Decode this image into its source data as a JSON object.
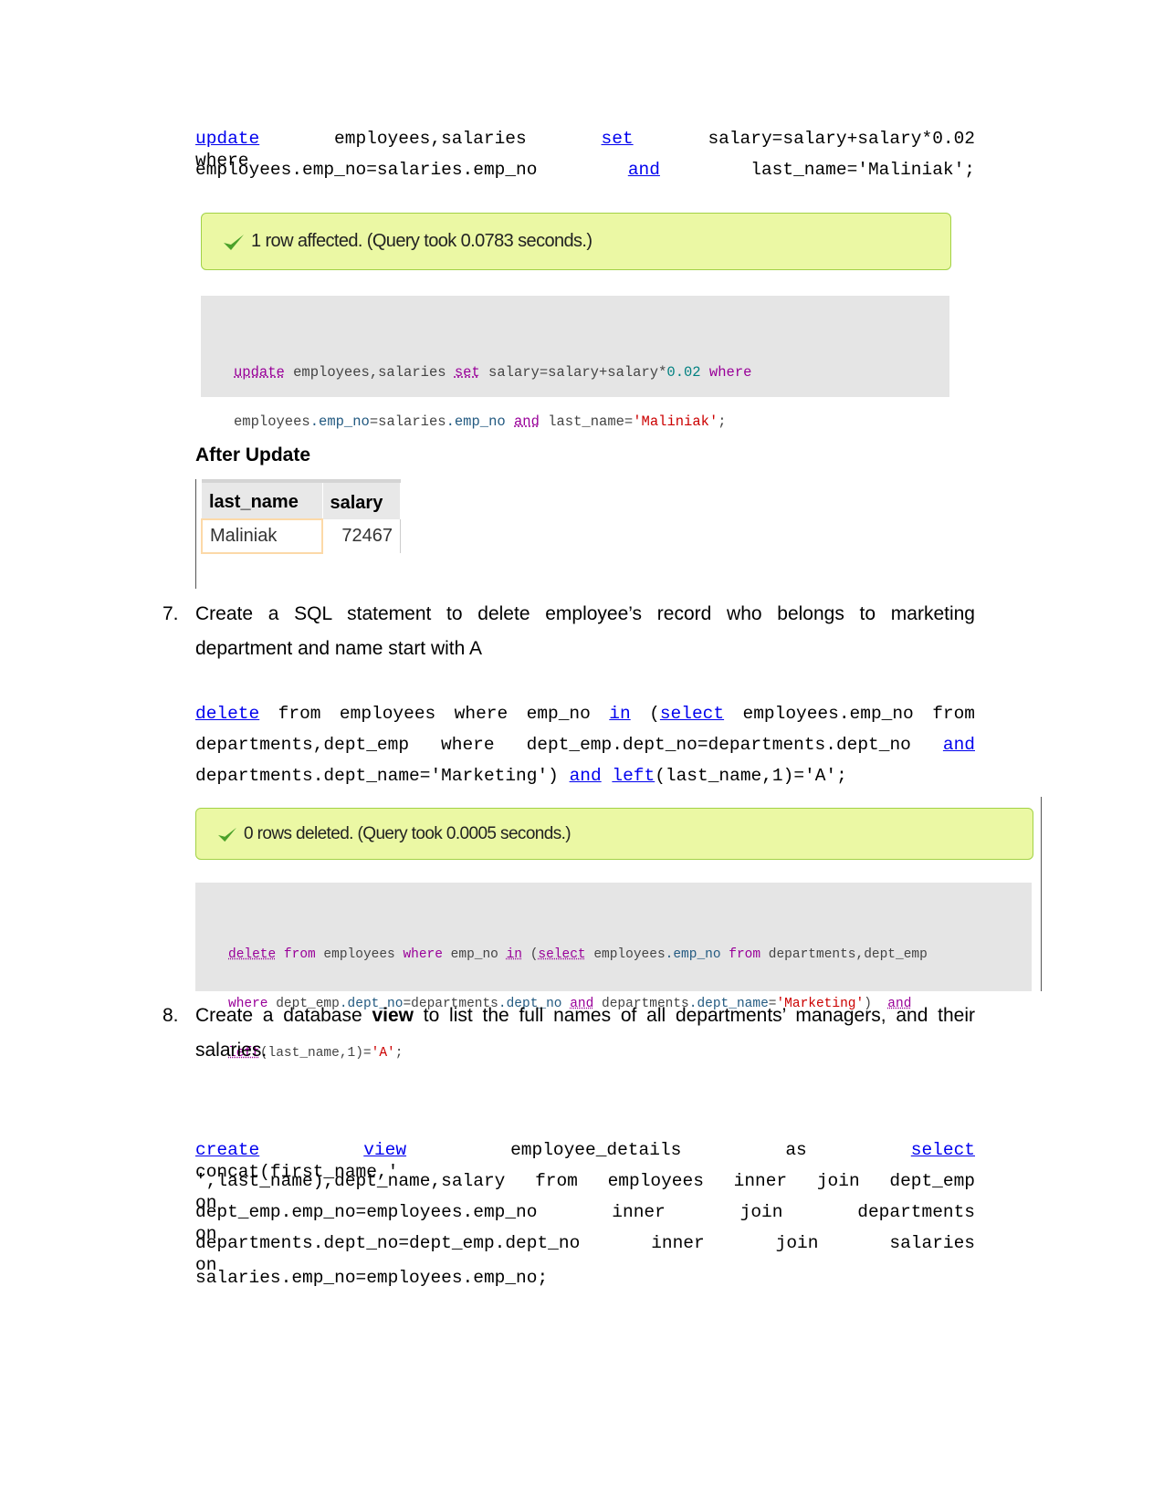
{
  "colors": {
    "link": "#0000ee",
    "success_bg": "#ebf8a4",
    "success_border": "#a2d246",
    "code_bg": "#e5e5e5",
    "keyword": "#990099",
    "field": "#235a81",
    "string": "#cc0000",
    "number": "#008080"
  },
  "update_sql": {
    "lines": [
      [
        {
          "t": "update",
          "link": true
        },
        {
          "t": "    employees,salaries    "
        },
        {
          "t": "set",
          "link": true
        },
        {
          "t": "    salary=salary+salary*0.02    where"
        }
      ],
      [
        {
          "t": "employees.emp_no=salaries.emp_no        "
        },
        {
          "t": "and",
          "link": true
        },
        {
          "t": "        last_name='Maliniak';"
        }
      ]
    ]
  },
  "update_result": {
    "icon": "check-icon",
    "message": "1 row affected. (Query took 0.0783 seconds.)"
  },
  "update_code": {
    "lines": [
      [
        {
          "t": "update",
          "c": "f"
        },
        {
          "t": " employees,salaries "
        },
        {
          "t": "set",
          "c": "f"
        },
        {
          "t": " salary=salary+salary*"
        },
        {
          "t": "0.02",
          "c": "n"
        },
        {
          "t": " "
        },
        {
          "t": "where",
          "c": "k"
        }
      ],
      [
        {
          "t": "employees"
        },
        {
          "t": ".emp_no",
          "c": "fd"
        },
        {
          "t": "=salaries"
        },
        {
          "t": ".emp_no",
          "c": "fd"
        },
        {
          "t": " "
        },
        {
          "t": "and",
          "c": "f"
        },
        {
          "t": " last_name="
        },
        {
          "t": "'Maliniak'",
          "c": "s"
        },
        {
          "t": ";"
        }
      ]
    ]
  },
  "after_update": {
    "heading": "After Update",
    "table": {
      "headers": [
        "last_name",
        "salary"
      ],
      "rows": [
        [
          "Maliniak",
          "72467"
        ]
      ]
    }
  },
  "q7": {
    "number": "7.",
    "lines": [
      "Create  a  SQL  statement  to  delete   employee’s  record  who  belongs  to  marketing",
      "department and name start with A"
    ]
  },
  "delete_sql": {
    "lines": [
      [
        {
          "t": "delete",
          "link": true
        },
        {
          "t": " from employees where emp_no "
        },
        {
          "t": "in",
          "link": true
        },
        {
          "t": " ("
        },
        {
          "t": "select",
          "link": true
        },
        {
          "t": " employees.emp_no from"
        }
      ],
      [
        {
          "t": "departments,dept_emp  where  dept_emp.dept_no=departments.dept_no  "
        },
        {
          "t": "and",
          "link": true
        }
      ],
      [
        {
          "t": "departments.dept_name='Marketing') "
        },
        {
          "t": "and",
          "link": true
        },
        {
          "t": " "
        },
        {
          "t": "left",
          "link": true
        },
        {
          "t": "(last_name,1)='A';"
        }
      ]
    ]
  },
  "delete_result": {
    "icon": "check-icon",
    "message": "0 rows deleted. (Query took 0.0005 seconds.)"
  },
  "delete_code": {
    "lines": [
      [
        {
          "t": "delete",
          "c": "f"
        },
        {
          "t": " "
        },
        {
          "t": "from",
          "c": "k"
        },
        {
          "t": " employees "
        },
        {
          "t": "where",
          "c": "k"
        },
        {
          "t": " emp_no "
        },
        {
          "t": "in",
          "c": "f"
        },
        {
          "t": " ("
        },
        {
          "t": "select",
          "c": "f"
        },
        {
          "t": " employees"
        },
        {
          "t": ".emp_no",
          "c": "fd"
        },
        {
          "t": " "
        },
        {
          "t": "from",
          "c": "k"
        },
        {
          "t": " departments,dept_emp"
        }
      ],
      [
        {
          "t": "where",
          "c": "k"
        },
        {
          "t": " dept_emp"
        },
        {
          "t": ".dept_no",
          "c": "fd"
        },
        {
          "t": "=departments"
        },
        {
          "t": ".dept_no",
          "c": "fd"
        },
        {
          "t": " "
        },
        {
          "t": "and",
          "c": "f"
        },
        {
          "t": " departments"
        },
        {
          "t": ".dept_name",
          "c": "fd"
        },
        {
          "t": "="
        },
        {
          "t": "'Marketing'",
          "c": "s"
        },
        {
          "t": ")  "
        },
        {
          "t": "and",
          "c": "f"
        }
      ],
      [
        {
          "t": "left",
          "c": "f"
        },
        {
          "t": "(last_name,1)="
        },
        {
          "t": "'A'",
          "c": "s"
        },
        {
          "t": ";"
        }
      ]
    ]
  },
  "q8": {
    "number": "8.",
    "line1_a": "Create  a  database ",
    "line1_bold": "view",
    "line1_b": " to  list  the  full  names  of  all  departments’  managers,  and  their",
    "line2": "salaries."
  },
  "view_sql": {
    "lines": [
      [
        {
          "t": "create",
          "link": true
        },
        {
          "t": "    "
        },
        {
          "t": "view",
          "link": true
        },
        {
          "t": "    employee_details    as    "
        },
        {
          "t": "select",
          "link": true
        },
        {
          "t": "    concat(first_name,'"
        }
      ],
      [
        {
          "t": "',last_name),dept_name,salary  from  employees  inner  join  dept_emp  on"
        }
      ],
      [
        {
          "t": "dept_emp.emp_no=employees.emp_no     inner     join     departments     on"
        }
      ],
      [
        {
          "t": "departments.dept_no=dept_emp.dept_no     inner     join     salaries     on"
        }
      ],
      [
        {
          "t": "salaries.emp_no=employees.emp_no;"
        }
      ]
    ]
  }
}
